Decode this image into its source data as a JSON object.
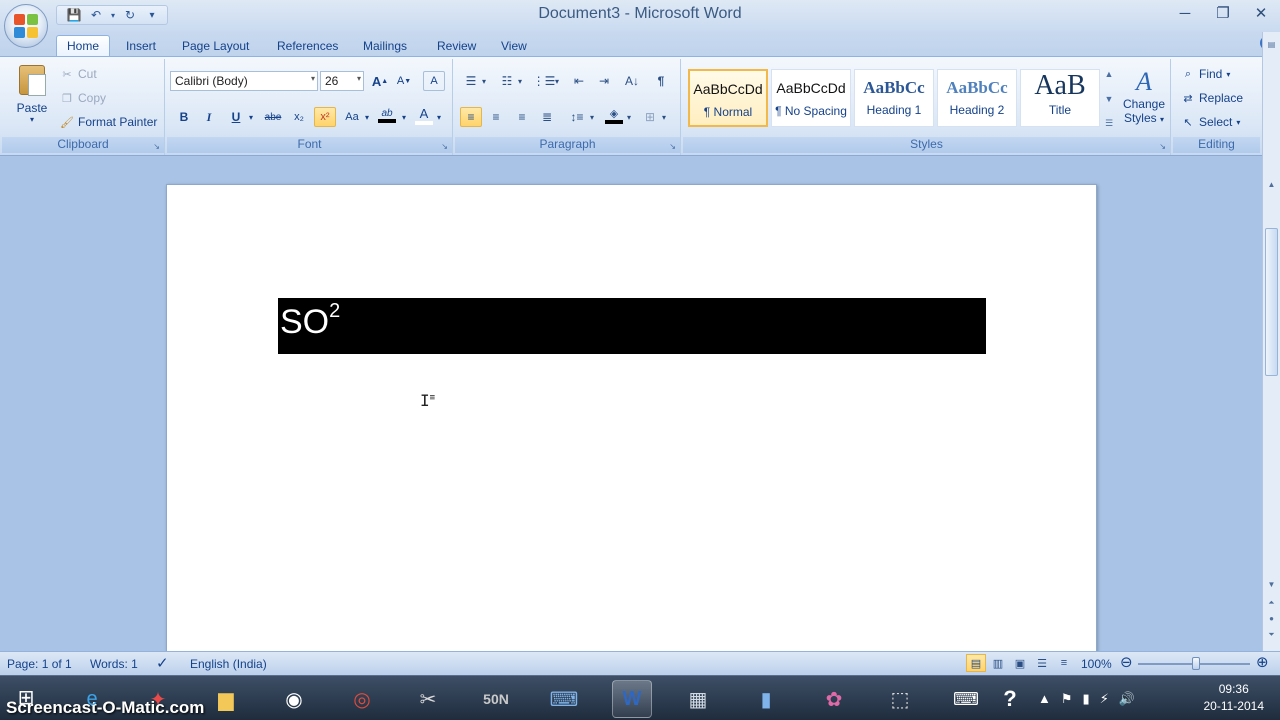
{
  "window": {
    "title": "Document3 - Microsoft Word",
    "minimize": "─",
    "restore": "❐",
    "close": "✕"
  },
  "qat": {
    "save": "💾",
    "undo": "↶",
    "redo": "↻",
    "customize": "▾"
  },
  "tabs": [
    {
      "label": "Home"
    },
    {
      "label": "Insert"
    },
    {
      "label": "Page Layout"
    },
    {
      "label": "References"
    },
    {
      "label": "Mailings"
    },
    {
      "label": "Review"
    },
    {
      "label": "View"
    }
  ],
  "help": "?",
  "clipboard": {
    "paste": "Paste",
    "cut": "Cut",
    "copy": "Copy",
    "format_painter": "Format Painter",
    "label": "Clipboard"
  },
  "font": {
    "name": "Calibri (Body)",
    "size": "26",
    "grow": "A",
    "shrink": "A",
    "clear": "A",
    "bold": "B",
    "italic": "I",
    "underline": "U",
    "strike": "abe",
    "subscript": "x₂",
    "superscript": "x²",
    "change_case": "Aa",
    "highlight": "ab",
    "color": "A",
    "label": "Font"
  },
  "paragraph": {
    "label": "Paragraph",
    "pilcrow": "¶"
  },
  "styles": {
    "items": [
      {
        "sample": "AaBbCcDd",
        "name": "¶ Normal"
      },
      {
        "sample": "AaBbCcDd",
        "name": "¶ No Spacing"
      },
      {
        "sample": "AaBbCc",
        "name": "Heading 1"
      },
      {
        "sample": "AaBbCc",
        "name": "Heading 2"
      },
      {
        "sample": "AaB",
        "name": "Title"
      }
    ],
    "change_line1": "Change",
    "change_line2": "Styles",
    "label": "Styles"
  },
  "editing": {
    "find": "Find",
    "replace": "Replace",
    "select": "Select",
    "label": "Editing"
  },
  "document": {
    "text": "SO",
    "superscript": "2"
  },
  "status": {
    "page": "Page: 1 of 1",
    "words": "Words: 1",
    "language": "English (India)",
    "zoom": "100%"
  },
  "taskbar": {
    "watermark": "Screencast-O-Matic.com",
    "time": "09:36",
    "date": "20-11-2014"
  },
  "colors": {
    "accent": "#15428b",
    "selected": "#ffd36a",
    "document_bg": "#a8c3e5"
  }
}
